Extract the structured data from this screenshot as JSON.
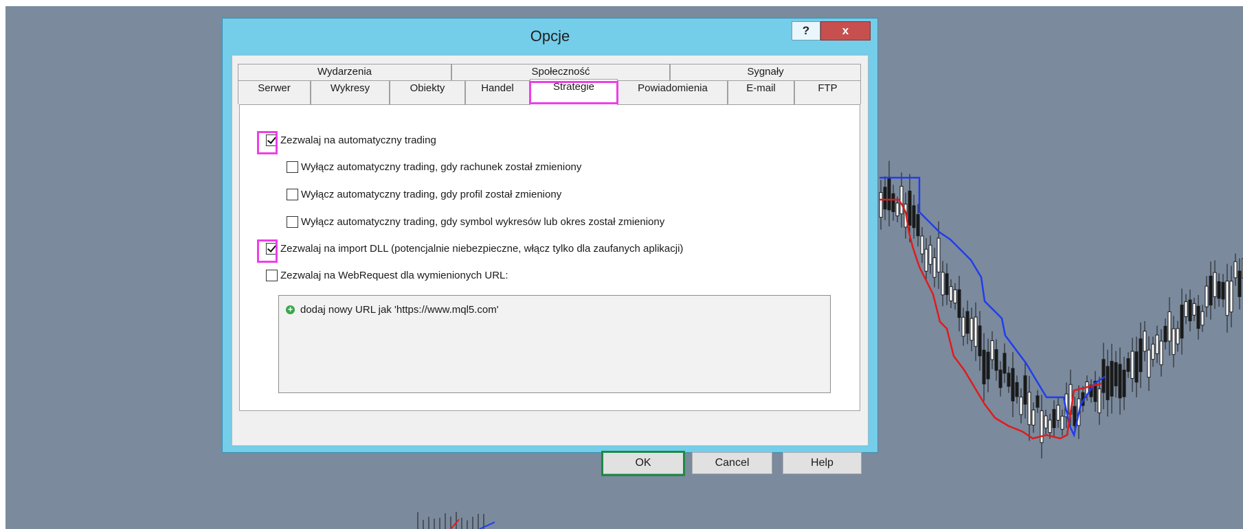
{
  "dialog": {
    "title": "Opcje",
    "help_label": "?",
    "close_label": "x"
  },
  "tabs": {
    "row1": [
      "Wydarzenia",
      "Społeczność",
      "Sygnały"
    ],
    "row2": [
      "Serwer",
      "Wykresy",
      "Obiekty",
      "Handel",
      "Strategie",
      "Powiadomienia",
      "E-mail",
      "FTP"
    ],
    "selected": "Strategie"
  },
  "options": [
    {
      "label": "Zezwalaj na automatyczny trading",
      "checked": true
    },
    {
      "label": "Wyłącz automatyczny trading, gdy rachunek został zmieniony",
      "checked": false
    },
    {
      "label": "Wyłącz automatyczny trading, gdy profil został zmieniony",
      "checked": false
    },
    {
      "label": "Wyłącz automatyczny trading, gdy symbol wykresów lub okres został zmieniony",
      "checked": false
    },
    {
      "label": "Zezwalaj na import DLL (potencjalnie niebezpieczne, włącz tylko dla zaufanych aplikacji)",
      "checked": true
    },
    {
      "label": "Zezwalaj na WebRequest dla wymienionych URL:",
      "checked": false
    }
  ],
  "url_list": {
    "add_label": "dodaj nowy URL jak 'https://www.mql5.com'",
    "add_icon": "plus-circle-icon"
  },
  "buttons": {
    "ok": "OK",
    "cancel": "Cancel",
    "help": "Help"
  },
  "colors": {
    "highlight_magenta": "#ee3ee8",
    "highlight_green": "#1d8a44",
    "chart_blue": "#1f3df0",
    "chart_red": "#e01b1b"
  }
}
